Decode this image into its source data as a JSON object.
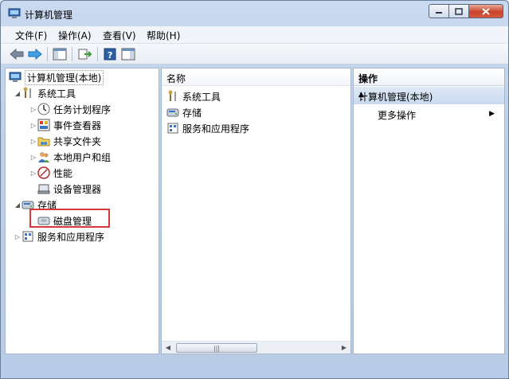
{
  "window": {
    "title": "计算机管理"
  },
  "menubar": [
    "文件(F)",
    "操作(A)",
    "查看(V)",
    "帮助(H)"
  ],
  "toolbar": [
    "back-icon",
    "forward-icon",
    "show-hide-console-tree-icon",
    "export-list-icon",
    "help-icon",
    "show-hide-action-pane-icon"
  ],
  "tree": [
    {
      "label": "计算机管理(本地)",
      "icon": "computer-management-icon",
      "indent": 0,
      "arrow": ""
    },
    {
      "label": "系统工具",
      "icon": "system-tools-icon",
      "indent": 1,
      "arrow": "◢"
    },
    {
      "label": "任务计划程序",
      "icon": "clock-icon",
      "indent": 2,
      "arrow": "▷"
    },
    {
      "label": "事件查看器",
      "icon": "event-viewer-icon",
      "indent": 2,
      "arrow": "▷"
    },
    {
      "label": "共享文件夹",
      "icon": "shared-folders-icon",
      "indent": 2,
      "arrow": "▷"
    },
    {
      "label": "本地用户和组",
      "icon": "users-icon",
      "indent": 2,
      "arrow": "▷"
    },
    {
      "label": "性能",
      "icon": "performance-icon",
      "indent": 2,
      "arrow": "▷"
    },
    {
      "label": "设备管理器",
      "icon": "device-manager-icon",
      "indent": 2,
      "arrow": ""
    },
    {
      "label": "存储",
      "icon": "storage-icon",
      "indent": 1,
      "arrow": "◢"
    },
    {
      "label": "磁盘管理",
      "icon": "disk-icon",
      "indent": 2,
      "arrow": ""
    },
    {
      "label": "服务和应用程序",
      "icon": "services-icon",
      "indent": 1,
      "arrow": "▷"
    }
  ],
  "middle": {
    "header": "名称",
    "items": [
      {
        "label": "系统工具",
        "icon": "system-tools-icon"
      },
      {
        "label": "存储",
        "icon": "storage-icon"
      },
      {
        "label": "服务和应用程序",
        "icon": "services-icon"
      }
    ]
  },
  "actions": {
    "header": "操作",
    "section": "计算机管理(本地)",
    "more": "更多操作"
  },
  "colors": {
    "highlight_box": "#d7383b",
    "action_section_bg": "#c8d9ee"
  }
}
